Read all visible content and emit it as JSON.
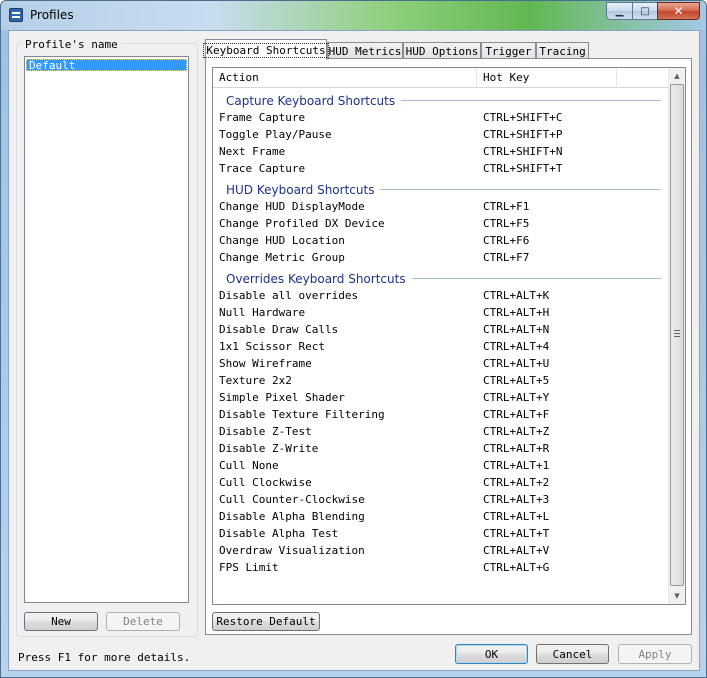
{
  "window": {
    "title": "Profiles",
    "minimize": "▁",
    "maximize": "□",
    "close": "✕"
  },
  "profiles": {
    "legend": "Profile's name",
    "items": [
      "Default"
    ],
    "new_label": "New",
    "delete_label": "Delete"
  },
  "tabs": [
    {
      "label": "Keyboard Shortcuts",
      "active": true
    },
    {
      "label": "HUD Metrics",
      "active": false
    },
    {
      "label": "HUD Options",
      "active": false
    },
    {
      "label": "Trigger",
      "active": false
    },
    {
      "label": "Tracing",
      "active": false
    }
  ],
  "shortcuts": {
    "columns": {
      "action": "Action",
      "hotkey": "Hot Key"
    },
    "groups": [
      {
        "title": "Capture Keyboard Shortcuts",
        "rows": [
          {
            "action": "Frame Capture",
            "key": "CTRL+SHIFT+C"
          },
          {
            "action": "Toggle Play/Pause",
            "key": "CTRL+SHIFT+P"
          },
          {
            "action": "Next Frame",
            "key": "CTRL+SHIFT+N"
          },
          {
            "action": "Trace Capture",
            "key": "CTRL+SHIFT+T"
          }
        ]
      },
      {
        "title": "HUD Keyboard Shortcuts",
        "rows": [
          {
            "action": "Change HUD DisplayMode",
            "key": "CTRL+F1"
          },
          {
            "action": "Change Profiled DX Device",
            "key": "CTRL+F5"
          },
          {
            "action": "Change HUD Location",
            "key": "CTRL+F6"
          },
          {
            "action": "Change Metric Group",
            "key": "CTRL+F7"
          }
        ]
      },
      {
        "title": "Overrides Keyboard Shortcuts",
        "rows": [
          {
            "action": "Disable all overrides",
            "key": "CTRL+ALT+K"
          },
          {
            "action": "Null Hardware",
            "key": "CTRL+ALT+H"
          },
          {
            "action": "Disable Draw Calls",
            "key": "CTRL+ALT+N"
          },
          {
            "action": "1x1 Scissor Rect",
            "key": "CTRL+ALT+4"
          },
          {
            "action": "Show Wireframe",
            "key": "CTRL+ALT+U"
          },
          {
            "action": "Texture 2x2",
            "key": "CTRL+ALT+5"
          },
          {
            "action": "Simple Pixel Shader",
            "key": "CTRL+ALT+Y"
          },
          {
            "action": "Disable Texture Filtering",
            "key": "CTRL+ALT+F"
          },
          {
            "action": "Disable Z-Test",
            "key": "CTRL+ALT+Z"
          },
          {
            "action": "Disable Z-Write",
            "key": "CTRL+ALT+R"
          },
          {
            "action": "Cull None",
            "key": "CTRL+ALT+1"
          },
          {
            "action": "Cull Clockwise",
            "key": "CTRL+ALT+2"
          },
          {
            "action": "Cull Counter-Clockwise",
            "key": "CTRL+ALT+3"
          },
          {
            "action": "Disable Alpha Blending",
            "key": "CTRL+ALT+L"
          },
          {
            "action": "Disable Alpha Test",
            "key": "CTRL+ALT+T"
          },
          {
            "action": "Overdraw Visualization",
            "key": "CTRL+ALT+V"
          },
          {
            "action": "FPS Limit",
            "key": "CTRL+ALT+G"
          }
        ]
      }
    ],
    "restore_label": "Restore Default"
  },
  "footer": {
    "status": "Press F1 for more details.",
    "ok_label": "OK",
    "cancel_label": "Cancel",
    "apply_label": "Apply"
  },
  "colors": {
    "selection": "#3399ff",
    "group_title": "#1e3287"
  }
}
